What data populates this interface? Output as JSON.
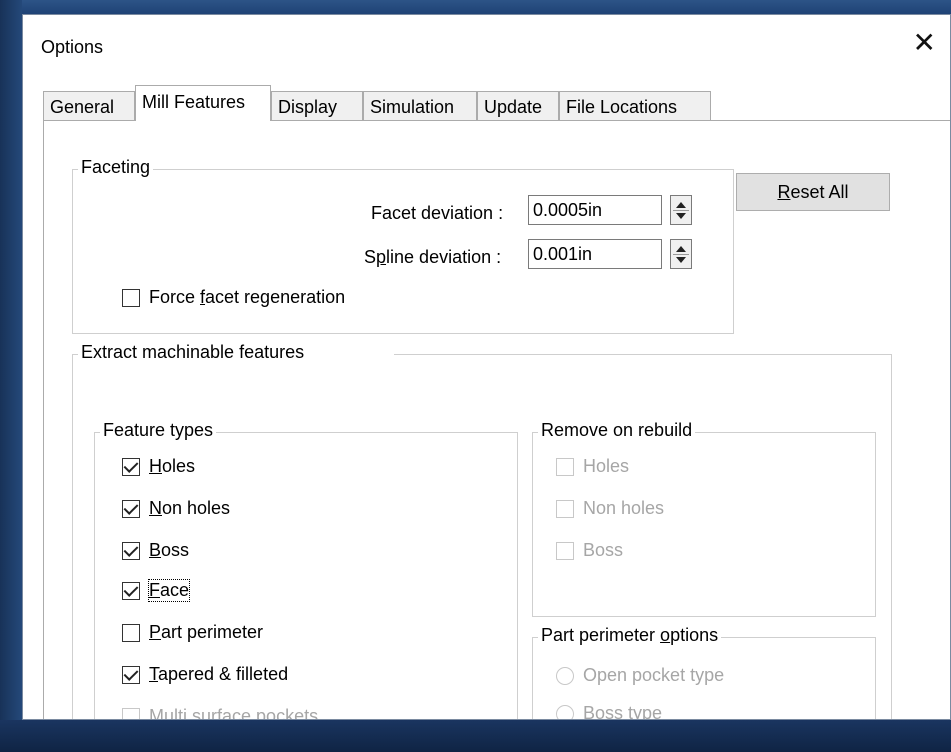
{
  "dialog": {
    "title": "Options",
    "close_glyph": "✕"
  },
  "tabs": [
    "General",
    "Mill Features",
    "Display",
    "Simulation",
    "Update",
    "File Locations"
  ],
  "faceting": {
    "label": "Faceting",
    "facet_deviation": {
      "pre": "Facet deviation :",
      "value": "0.0005in"
    },
    "spline_deviation": {
      "pre": "S",
      "ul": "p",
      "post": "line deviation :",
      "value": "0.001in"
    },
    "force_regen": {
      "pre": "Force ",
      "ul": "f",
      "post": "acet regeneration",
      "checked": false
    }
  },
  "reset_all": {
    "ul": "R",
    "rest": "eset All"
  },
  "extract": {
    "label": "Extract machinable features",
    "feature_types": {
      "label": "Feature types",
      "items": [
        {
          "ul": "H",
          "rest": "oles",
          "checked": true
        },
        {
          "ul": "N",
          "rest": "on holes",
          "checked": true
        },
        {
          "ul": "B",
          "rest": "oss",
          "checked": true
        },
        {
          "ul": "F",
          "rest": "ace",
          "checked": true
        },
        {
          "ul": "P",
          "rest": "art perimeter",
          "checked": false
        },
        {
          "ul": "T",
          "rest": "apered & filleted",
          "checked": true
        },
        {
          "pre": "Multi ",
          "ul": "s",
          "rest": "urface pockets",
          "checked": false,
          "disabled": true
        }
      ]
    },
    "remove_on_rebuild": {
      "label": "Remove on rebuild",
      "items": [
        "Holes",
        "Non holes",
        "Boss"
      ]
    },
    "part_perimeter_options": {
      "label_pre": "Part perimeter ",
      "label_ul": "o",
      "label_post": "ptions",
      "items": [
        "Open pocket type",
        "Boss type"
      ]
    }
  }
}
